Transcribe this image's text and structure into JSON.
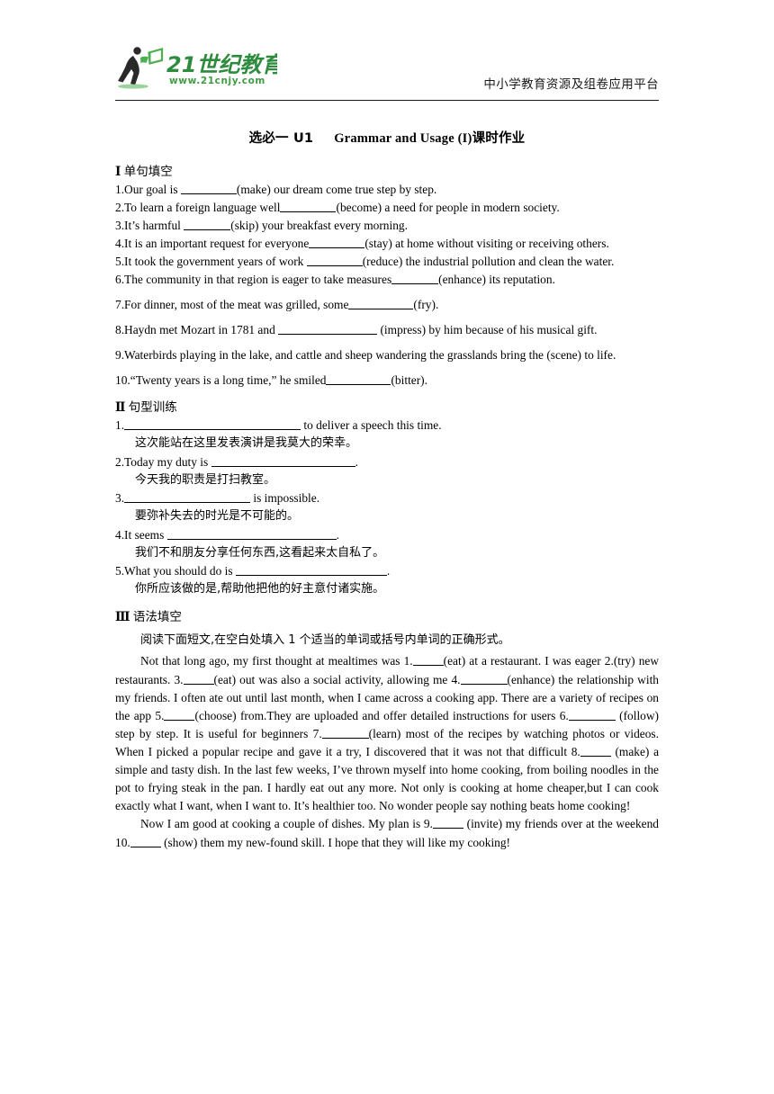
{
  "header": {
    "logo_text_main": "21世纪教育",
    "logo_text_url": "www.21cnjy.com",
    "logo_icon": "running-person-with-book-icon",
    "tagline": "中小学教育资源及组卷应用平台",
    "brand_green": "#3f9c45",
    "brand_dark_green": "#2f7a37"
  },
  "title": {
    "full": "选必一 U1　　Grammar and Usage (I)课时作业",
    "part_cn_prefix": "选必一 U1",
    "part_en": "Grammar and Usage (I)",
    "part_cn_suffix": "课时作业"
  },
  "section1": {
    "heading_num": "Ⅰ",
    "heading_label": "单句填空",
    "items": [
      {
        "num": "1.",
        "before": "Our goal is ",
        "blank": "b-md",
        "after": "(make) our dream come true step by step."
      },
      {
        "num": "2.",
        "before": "To learn a foreign language well",
        "blank": "b-md",
        "after": "(become) a need for people in modern society."
      },
      {
        "num": "3.",
        "before": "It’s harmful ",
        "blank": "b-sm",
        "after": "(skip) your breakfast every morning."
      },
      {
        "num": "4.",
        "before": "It is an important request for everyone",
        "blank": "b-md",
        "after": "(stay) at home without visiting or receiving others."
      },
      {
        "num": "5.",
        "before": "It took the government years of work ",
        "blank": "b-md",
        "after": "(reduce) the industrial pollution and clean the water."
      },
      {
        "num": "6.",
        "before": "The community in that region is eager to take measures",
        "blank": "b-sm",
        "after": "(enhance) its reputation."
      },
      {
        "num": "7.",
        "before": "For dinner, most of the meat was grilled, some",
        "blank": "b-lg",
        "after": "(fry)."
      },
      {
        "num": "8.",
        "before": "Haydn met Mozart in 1781 and ",
        "blank": "b-xl",
        "after": " (impress) by him because of his musical gift."
      },
      {
        "num": "9.",
        "before": "Waterbirds playing in the lake, and cattle and sheep wandering the grasslands bring the (scene) to life.",
        "blank": "",
        "after": ""
      },
      {
        "num": "10.",
        "before": "“Twenty years is a long time,” he smiled",
        "blank": "b-lg",
        "after": "(bitter)."
      }
    ]
  },
  "section2": {
    "heading_num": "Ⅱ",
    "heading_label": "句型训练",
    "items": [
      {
        "num": "1.",
        "before": "",
        "blank": "b-w1",
        "after": " to deliver a speech this time.",
        "cn": "这次能站在这里发表演讲是我莫大的荣幸。"
      },
      {
        "num": "2.",
        "before": "Today my duty is ",
        "blank": "b-w2",
        "after": ".",
        "cn": "今天我的职责是打扫教室。"
      },
      {
        "num": "3.",
        "before": "",
        "blank": "b-w3",
        "after": " is impossible.",
        "cn": "要弥补失去的时光是不可能的。"
      },
      {
        "num": "4.",
        "before": "It seems ",
        "blank": "b-w4",
        "after": ".",
        "cn": "我们不和朋友分享任何东西,这看起来太自私了。"
      },
      {
        "num": "5.",
        "before": "What you should do is ",
        "blank": "b-w5",
        "after": ".",
        "cn": "你所应该做的是,帮助他把他的好主意付诸实施。"
      }
    ]
  },
  "section3": {
    "heading_num": "Ⅲ",
    "heading_label": "语法填空",
    "instruction": "阅读下面短文,在空白处填入 1 个适当的单词或括号内单词的正确形式。",
    "paragraph1": [
      {
        "t": "Not that long ago, my first thought at mealtimes was 1."
      },
      {
        "blank": "b-xs"
      },
      {
        "t": "(eat) at a restaurant. I was eager 2.(try) new restaurants. 3."
      },
      {
        "blank": "b-xs"
      },
      {
        "t": "(eat) out was also a social activity, allowing me 4."
      },
      {
        "blank": "b-sm"
      },
      {
        "t": "(enhance) the relationship with my friends. I often ate out until last month, when I came across a cooking app. There are a variety of recipes on the app 5."
      },
      {
        "blank": "b-xs"
      },
      {
        "t": "(choose) from.They are uploaded and offer detailed instructions for users 6."
      },
      {
        "blank": "b-sm"
      },
      {
        "t": " (follow) step by step. It is useful for beginners 7."
      },
      {
        "blank": "b-sm"
      },
      {
        "t": "(learn) most of the recipes by watching photos or videos. When I picked a popular recipe and gave it a try, I discovered that it was not that difficult 8."
      },
      {
        "blank": "b-xs"
      },
      {
        "t": " (make) a simple and tasty dish. In the last few weeks, I’ve thrown myself into home cooking, from boiling noodles in the pot to frying steak in the pan. I hardly eat out any more. Not only is cooking at home cheaper,but I can cook exactly what I want, when I want to. It’s healthier too. No wonder people say nothing beats home cooking!"
      }
    ],
    "paragraph2": [
      {
        "t": "Now I am good at cooking a couple of dishes. My plan is 9."
      },
      {
        "blank": "b-xs"
      },
      {
        "t": " (invite) my friends over at the weekend 10."
      },
      {
        "blank": "b-xs"
      },
      {
        "t": " (show) them my new-found skill. I hope that they will like my cooking!"
      }
    ]
  }
}
